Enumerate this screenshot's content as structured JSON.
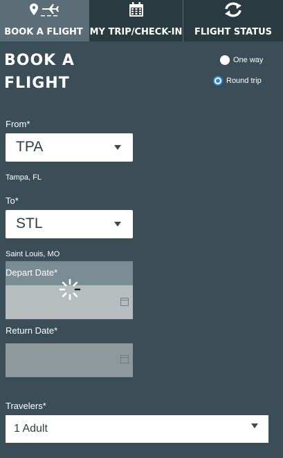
{
  "tabs": [
    {
      "label": "BOOK A FLIGHT",
      "icon": "location-plane-icon",
      "active": true
    },
    {
      "label": "MY TRIP/CHECK-IN",
      "icon": "calendar-icon",
      "active": false
    },
    {
      "label": "FLIGHT STATUS",
      "icon": "refresh-icon",
      "active": false
    }
  ],
  "form": {
    "title": "BOOK A FLIGHT",
    "trip_type": {
      "one_way": "One way",
      "round_trip": "Round trip",
      "selected": "Round trip"
    },
    "from": {
      "label": "From*",
      "value": "TPA",
      "city": "Tampa, FL"
    },
    "to": {
      "label": "To*",
      "value": "STL",
      "city": "Saint Louis, MO"
    },
    "depart": {
      "label": "Depart Date*",
      "value": ""
    },
    "return": {
      "label": "Return Date*",
      "value": ""
    },
    "travelers": {
      "label": "Travelers*",
      "value": "1 Adult"
    }
  },
  "colors": {
    "background": "#3b4e57",
    "tab_bar": "#2a3a41",
    "active_tab": "#5b6e77",
    "radio_accent": "#2b86d0"
  }
}
